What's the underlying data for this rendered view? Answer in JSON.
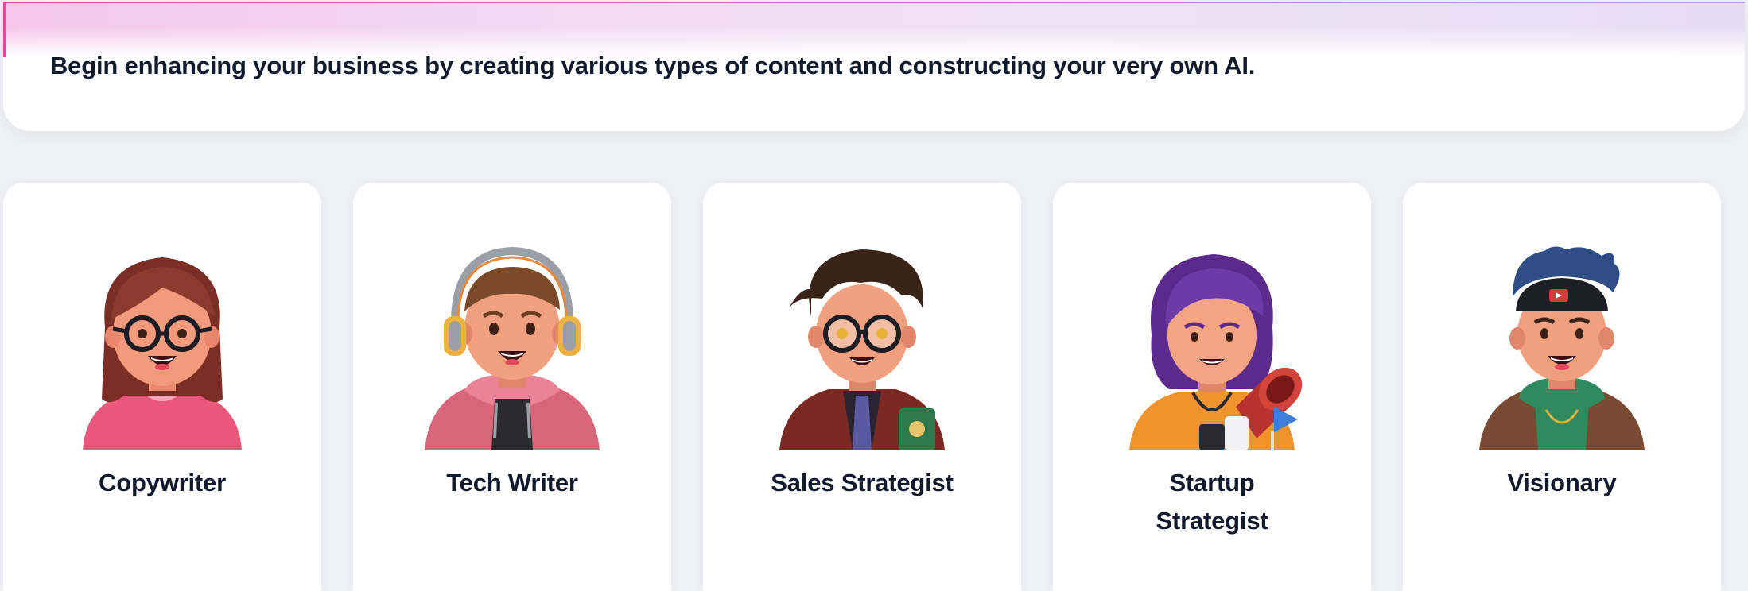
{
  "banner": {
    "text": "Begin enhancing your business by creating various types of content and constructing your very own AI."
  },
  "personas": [
    {
      "label": "Copywriter",
      "icon": "copywriter-avatar-icon"
    },
    {
      "label": "Tech Writer",
      "icon": "tech-writer-avatar-icon"
    },
    {
      "label": "Sales Strategist",
      "icon": "sales-strategist-avatar-icon"
    },
    {
      "label": "Startup Strategist",
      "icon": "startup-strategist-avatar-icon"
    },
    {
      "label": "Visionary",
      "icon": "visionary-avatar-icon"
    }
  ],
  "colors": {
    "page_background": "#eff0f3",
    "card_background": "#ffffff",
    "text": "#111a2c",
    "banner_gradient_start": "#f3c7e9",
    "banner_gradient_end": "#e8dcf4",
    "accent_pink": "#e4489a"
  }
}
